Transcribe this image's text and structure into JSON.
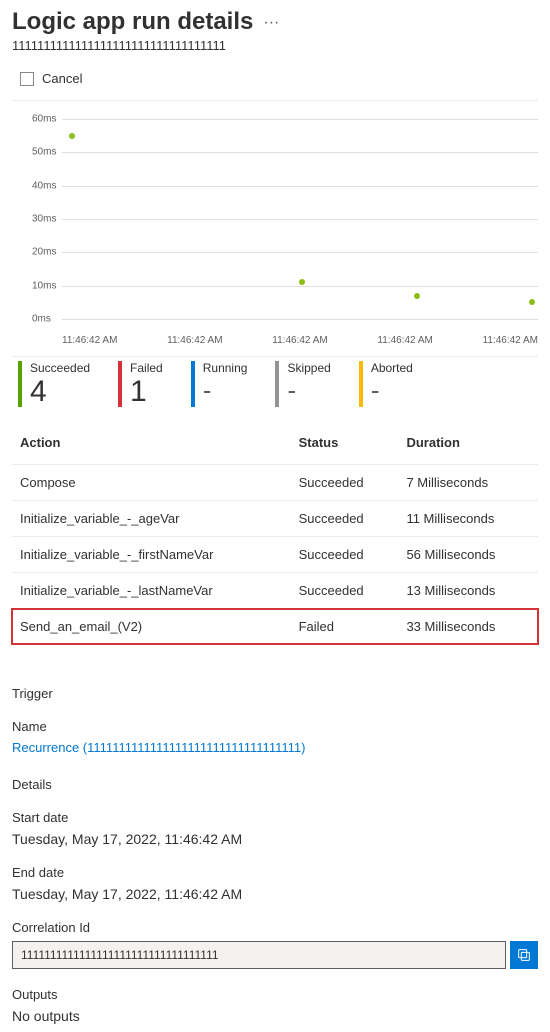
{
  "header": {
    "title": "Logic app run details",
    "run_id": "1111111111111111111111111111111111"
  },
  "toolbar": {
    "cancel_label": "Cancel"
  },
  "chart_data": {
    "type": "scatter",
    "title": "",
    "xlabel": "",
    "ylabel": "",
    "ylim": [
      0,
      60
    ],
    "y_ticks": [
      "0ms",
      "10ms",
      "20ms",
      "30ms",
      "40ms",
      "50ms",
      "60ms"
    ],
    "x_ticks": [
      "11:46:42 AM",
      "11:46:42 AM",
      "11:46:42 AM",
      "11:46:42 AM",
      "11:46:42 AM"
    ],
    "series": [
      {
        "name": "Duration",
        "x": [
          0,
          1,
          2,
          3,
          4
        ],
        "values": [
          55,
          null,
          11,
          7,
          5
        ]
      }
    ]
  },
  "status_summary": [
    {
      "label": "Succeeded",
      "value": "4",
      "bar": "bar-succ"
    },
    {
      "label": "Failed",
      "value": "1",
      "bar": "bar-fail"
    },
    {
      "label": "Running",
      "value": "-",
      "bar": "bar-run",
      "dash": true
    },
    {
      "label": "Skipped",
      "value": "-",
      "bar": "bar-skip",
      "dash": true
    },
    {
      "label": "Aborted",
      "value": "-",
      "bar": "bar-abort",
      "dash": true
    }
  ],
  "actions_table": {
    "headers": {
      "action": "Action",
      "status": "Status",
      "duration": "Duration"
    },
    "rows": [
      {
        "action": "Compose",
        "status": "Succeeded",
        "duration": "7 Milliseconds"
      },
      {
        "action": "Initialize_variable_-_ageVar",
        "status": "Succeeded",
        "duration": "11 Milliseconds"
      },
      {
        "action": "Initialize_variable_-_firstNameVar",
        "status": "Succeeded",
        "duration": "56 Milliseconds"
      },
      {
        "action": "Initialize_variable_-_lastNameVar",
        "status": "Succeeded",
        "duration": "13 Milliseconds"
      },
      {
        "action": "Send_an_email_(V2)",
        "status": "Failed",
        "duration": "33 Milliseconds",
        "highlight": true
      }
    ]
  },
  "trigger": {
    "section_label": "Trigger",
    "name_label": "Name",
    "name_link_text": "Recurrence  (1111111111111111111111111111111111)"
  },
  "details": {
    "section_label": "Details",
    "start_label": "Start date",
    "start_value": "Tuesday, May 17, 2022, 11:46:42 AM",
    "end_label": "End date",
    "end_value": "Tuesday, May 17, 2022, 11:46:42 AM",
    "corr_label": "Correlation Id",
    "corr_value": "1111111111111111111111111111111111",
    "outputs_label": "Outputs",
    "outputs_value": "No outputs"
  }
}
